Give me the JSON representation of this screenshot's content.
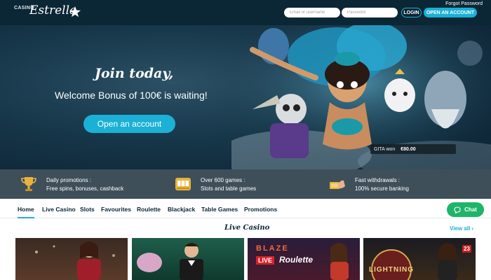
{
  "header": {
    "logo_small": "CASINO",
    "logo_script": "Estrella",
    "forgot_password": "Forgot Password",
    "email_placeholder": "Email or username",
    "password_placeholder": "Password",
    "login_label": "LOGIN",
    "open_account_label": "OPEN AN ACCOUNT"
  },
  "hero": {
    "title": "Join today,",
    "subtitle": "Welcome Bonus of 100€ is waiting!",
    "cta_label": "Open an account",
    "win_user": "GITA won",
    "win_amount": "€80.00"
  },
  "strip": {
    "items": [
      {
        "title": "Daily promotions :",
        "desc": "Free spins, bonuses, cashback",
        "icon": "trophy-icon"
      },
      {
        "title": "Over 600 games :",
        "desc": "Slots and table games",
        "icon": "slot-machine-icon"
      },
      {
        "title": "Fast withdrawals :",
        "desc": "100% secure banking",
        "icon": "hand-cash-icon"
      }
    ]
  },
  "nav": {
    "items": [
      "Home",
      "Live Casino",
      "Slots",
      "Favourites",
      "Roulette",
      "Blackjack",
      "Table Games",
      "Promotions"
    ],
    "active": "Home"
  },
  "chat": {
    "label": "Chat"
  },
  "live_casino": {
    "title": "Live Casino",
    "view_all": "View all",
    "tiles": [
      {
        "label": ""
      },
      {
        "label": ""
      },
      {
        "label_top": "BLAZE",
        "label_live": "LIVE",
        "label_game": "Roulette"
      },
      {
        "label": "LIGHTNING",
        "number": "23"
      }
    ]
  },
  "colors": {
    "accent": "#1bb0d6",
    "header_bg": "#0b2634",
    "strip_bg": "#3e4f5a",
    "chat": "#1fb46a"
  }
}
